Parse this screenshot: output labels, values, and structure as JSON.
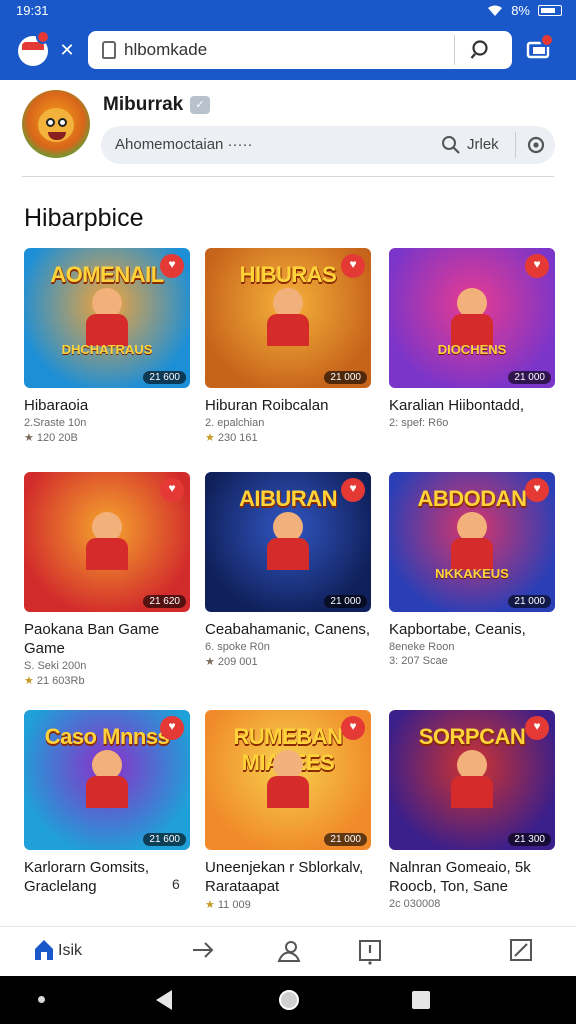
{
  "status": {
    "time": "19:31",
    "battery": "8%"
  },
  "topbar": {
    "search_value": "hlbomkade",
    "icons": [
      "app-logo-icon",
      "close-icon",
      "lock-icon",
      "search-icon",
      "cast-icon"
    ]
  },
  "profile": {
    "name": "Miburrak",
    "search_text": "Ahomemoctaian ·····",
    "search_label": "Jrlek"
  },
  "section_title": "Hibarpbice",
  "games": [
    {
      "thumb_title": "AOMENAIL",
      "thumb_sub": "DHCHATRAUS",
      "badge": "21 600",
      "title": "Hibaraoia",
      "meta1": "2.Sraste 10n",
      "meta2": "120 20B",
      "star": "grey",
      "colors": [
        "#1d8fd6",
        "#f3a43a"
      ]
    },
    {
      "thumb_title": "HIBURAS",
      "thumb_sub": "",
      "badge": "21 000",
      "title": "Hiburan Roibcalan",
      "meta1": "2. epalchian",
      "meta2": "230 161",
      "star": "gold",
      "colors": [
        "#c7641b",
        "#f6b23b"
      ]
    },
    {
      "thumb_title": "",
      "thumb_sub": "DIOCHENS",
      "badge": "21 000",
      "title": "Karalian Hiibontadd,",
      "meta1": "2: spef: R6o",
      "meta2": "",
      "star": "",
      "colors": [
        "#7b35c9",
        "#e83b8f"
      ]
    },
    {
      "thumb_title": "",
      "thumb_sub": "",
      "badge": "21 620",
      "title": "Paokana Ban Game Game",
      "meta1": "S. Seki 200n",
      "meta2": "21 603Rb",
      "star": "gold",
      "colors": [
        "#d22b2b",
        "#f5a52e"
      ]
    },
    {
      "thumb_title": "AIBURAN",
      "thumb_sub": "",
      "badge": "21 000",
      "title": "Ceabahamanic, Canens,",
      "meta1": "6. spoke R0n",
      "meta2": "209 001",
      "star": "grey",
      "colors": [
        "#10205a",
        "#3257c4"
      ]
    },
    {
      "thumb_title": "ABDODAN",
      "thumb_sub": "NKKAKEUS",
      "badge": "21 000",
      "title": "Kapbortabe, Ceanis,",
      "meta1": "8eneke Roon",
      "meta2": "3: 207 Scae",
      "star": "",
      "colors": [
        "#2a3fb6",
        "#d9356a"
      ]
    },
    {
      "thumb_title": "Caso Mnnss",
      "thumb_sub": "",
      "badge": "21 600",
      "title": "Karlorarn Gomsits, Graclelang",
      "meta1": "",
      "meta2": "",
      "star": "",
      "colors": [
        "#1fa0d8",
        "#8c2fc8"
      ]
    },
    {
      "thumb_title": "RUMEBAN MIATEES",
      "thumb_sub": "",
      "badge": "21 000",
      "title": "Uneenjekan r Sblorkalv, Rarataapat",
      "meta1": "",
      "meta2": "11 009",
      "star": "gold",
      "colors": [
        "#f08a2a",
        "#f6d04d"
      ]
    },
    {
      "thumb_title": "SORPCAN",
      "thumb_sub": "",
      "badge": "21 300",
      "title": "Nalnran Gomeaio, 5k Roocb, Ton, Sane",
      "meta1": "2c 030008",
      "meta2": "",
      "star": "",
      "colors": [
        "#3b1f8a",
        "#d0332f"
      ]
    }
  ],
  "card_extra": "6",
  "bottom_nav": {
    "home_label": "Isik"
  }
}
